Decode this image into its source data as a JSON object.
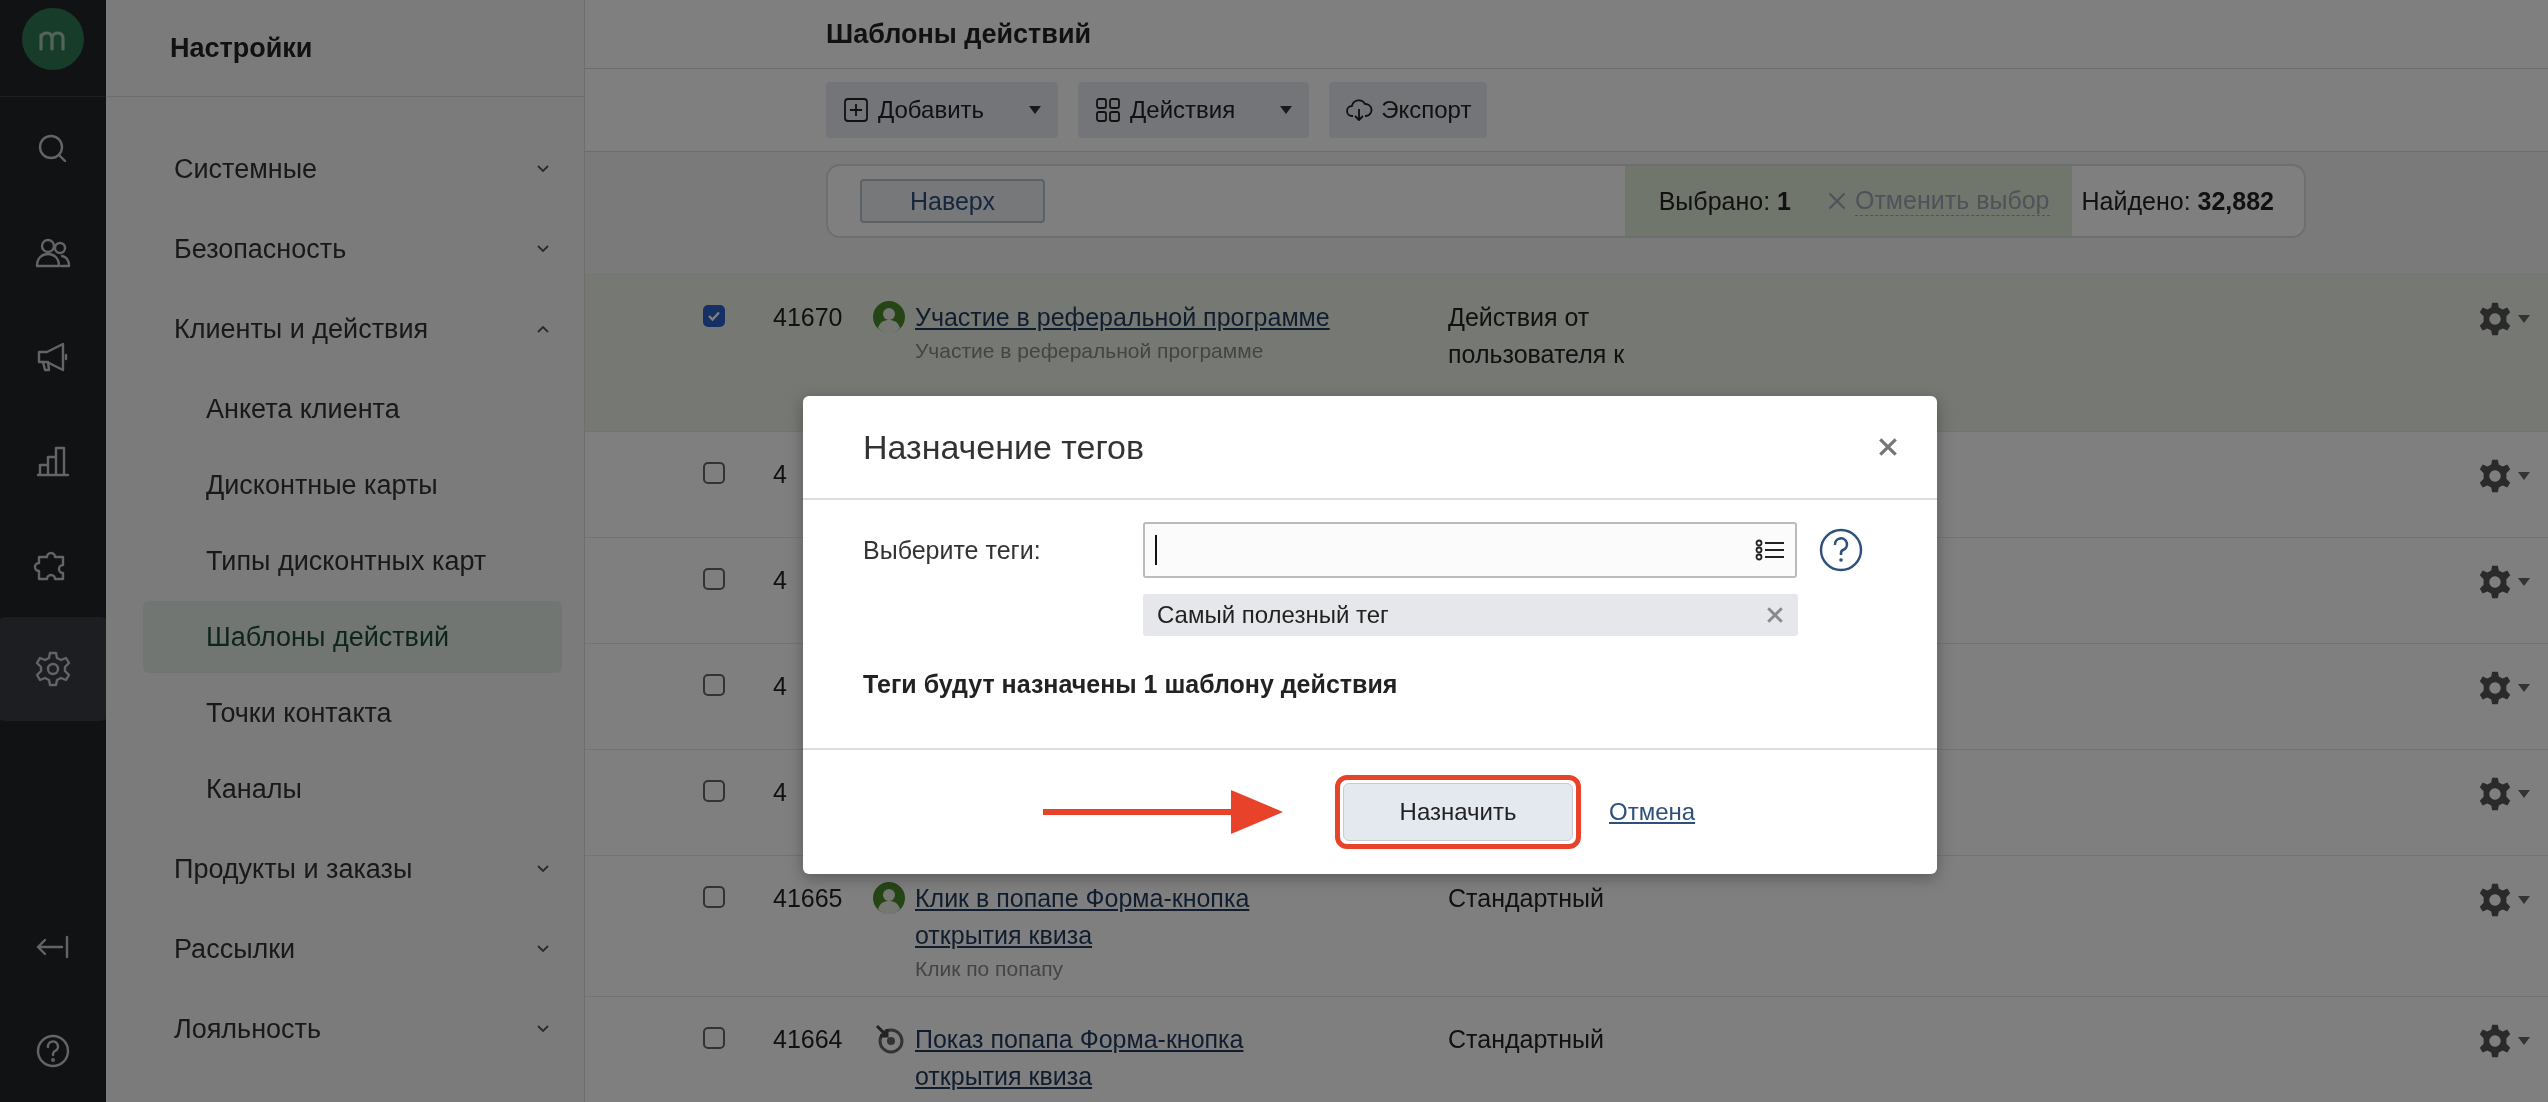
{
  "rail": [
    {
      "kind": "logo"
    },
    {
      "kind": "search",
      "selected": false
    },
    {
      "kind": "users",
      "selected": false
    },
    {
      "kind": "megaphone",
      "selected": false
    },
    {
      "kind": "chart",
      "selected": false
    },
    {
      "kind": "puzzle",
      "selected": false
    },
    {
      "kind": "settings",
      "selected": true
    },
    {
      "kind": "collapse",
      "selected": false
    },
    {
      "kind": "help",
      "selected": false
    }
  ],
  "sidebar": {
    "title": "Настройки",
    "items": [
      {
        "label": "Системные",
        "expanded": false
      },
      {
        "label": "Безопасность",
        "expanded": false
      },
      {
        "label": "Клиенты и действия",
        "expanded": true,
        "children": [
          {
            "label": "Анкета клиента",
            "selected": false
          },
          {
            "label": "Дисконтные карты",
            "selected": false
          },
          {
            "label": "Типы дисконтных карт",
            "selected": false
          },
          {
            "label": "Шаблоны действий",
            "selected": true
          },
          {
            "label": "Точки контакта",
            "selected": false
          },
          {
            "label": "Каналы",
            "selected": false
          }
        ]
      },
      {
        "label": "Продукты и заказы",
        "expanded": false
      },
      {
        "label": "Рассылки",
        "expanded": false
      },
      {
        "label": "Лояльность",
        "expanded": false
      }
    ]
  },
  "page_title": "Шаблоны действий",
  "toolbar": [
    {
      "kind": "add",
      "label": "Добавить",
      "dropdown": true
    },
    {
      "kind": "actions",
      "label": "Действия",
      "dropdown": true
    },
    {
      "kind": "export",
      "label": "Экспорт",
      "dropdown": false
    }
  ],
  "top_button": "Наверх",
  "selection": {
    "selected_label": "Выбрано:",
    "selected_count": "1",
    "clear": "Отменить выбор",
    "found_label": "Найдено:",
    "found_count": "32,882"
  },
  "rows": [
    {
      "checked": true,
      "id": "41670",
      "kind": "user",
      "title": "Участие в реферальной программе",
      "subtitle": "Участие в реферальной программе",
      "type": "Действия от пользователя к"
    },
    {
      "checked": false,
      "id": "4"
    },
    {
      "checked": false,
      "id": "4"
    },
    {
      "checked": false,
      "id": "4"
    },
    {
      "checked": false,
      "id": "4"
    },
    {
      "checked": false,
      "id": "41665",
      "kind": "user",
      "title": "Клик в попапе Форма-кнопка открытия квиза",
      "subtitle": "Клик по попапу",
      "type": "Стандартный"
    },
    {
      "checked": false,
      "id": "41664",
      "kind": "target",
      "title": "Показ попапа Форма-кнопка открытия квиза",
      "type": "Стандартный"
    }
  ],
  "modal": {
    "title": "Назначение тегов",
    "field_label": "Выберите теги:",
    "tags": [
      {
        "label": "Самый полезный тег"
      }
    ],
    "summary": "Теги будут назначены 1 шаблону действия",
    "primary": "Назначить",
    "cancel": "Отмена"
  }
}
